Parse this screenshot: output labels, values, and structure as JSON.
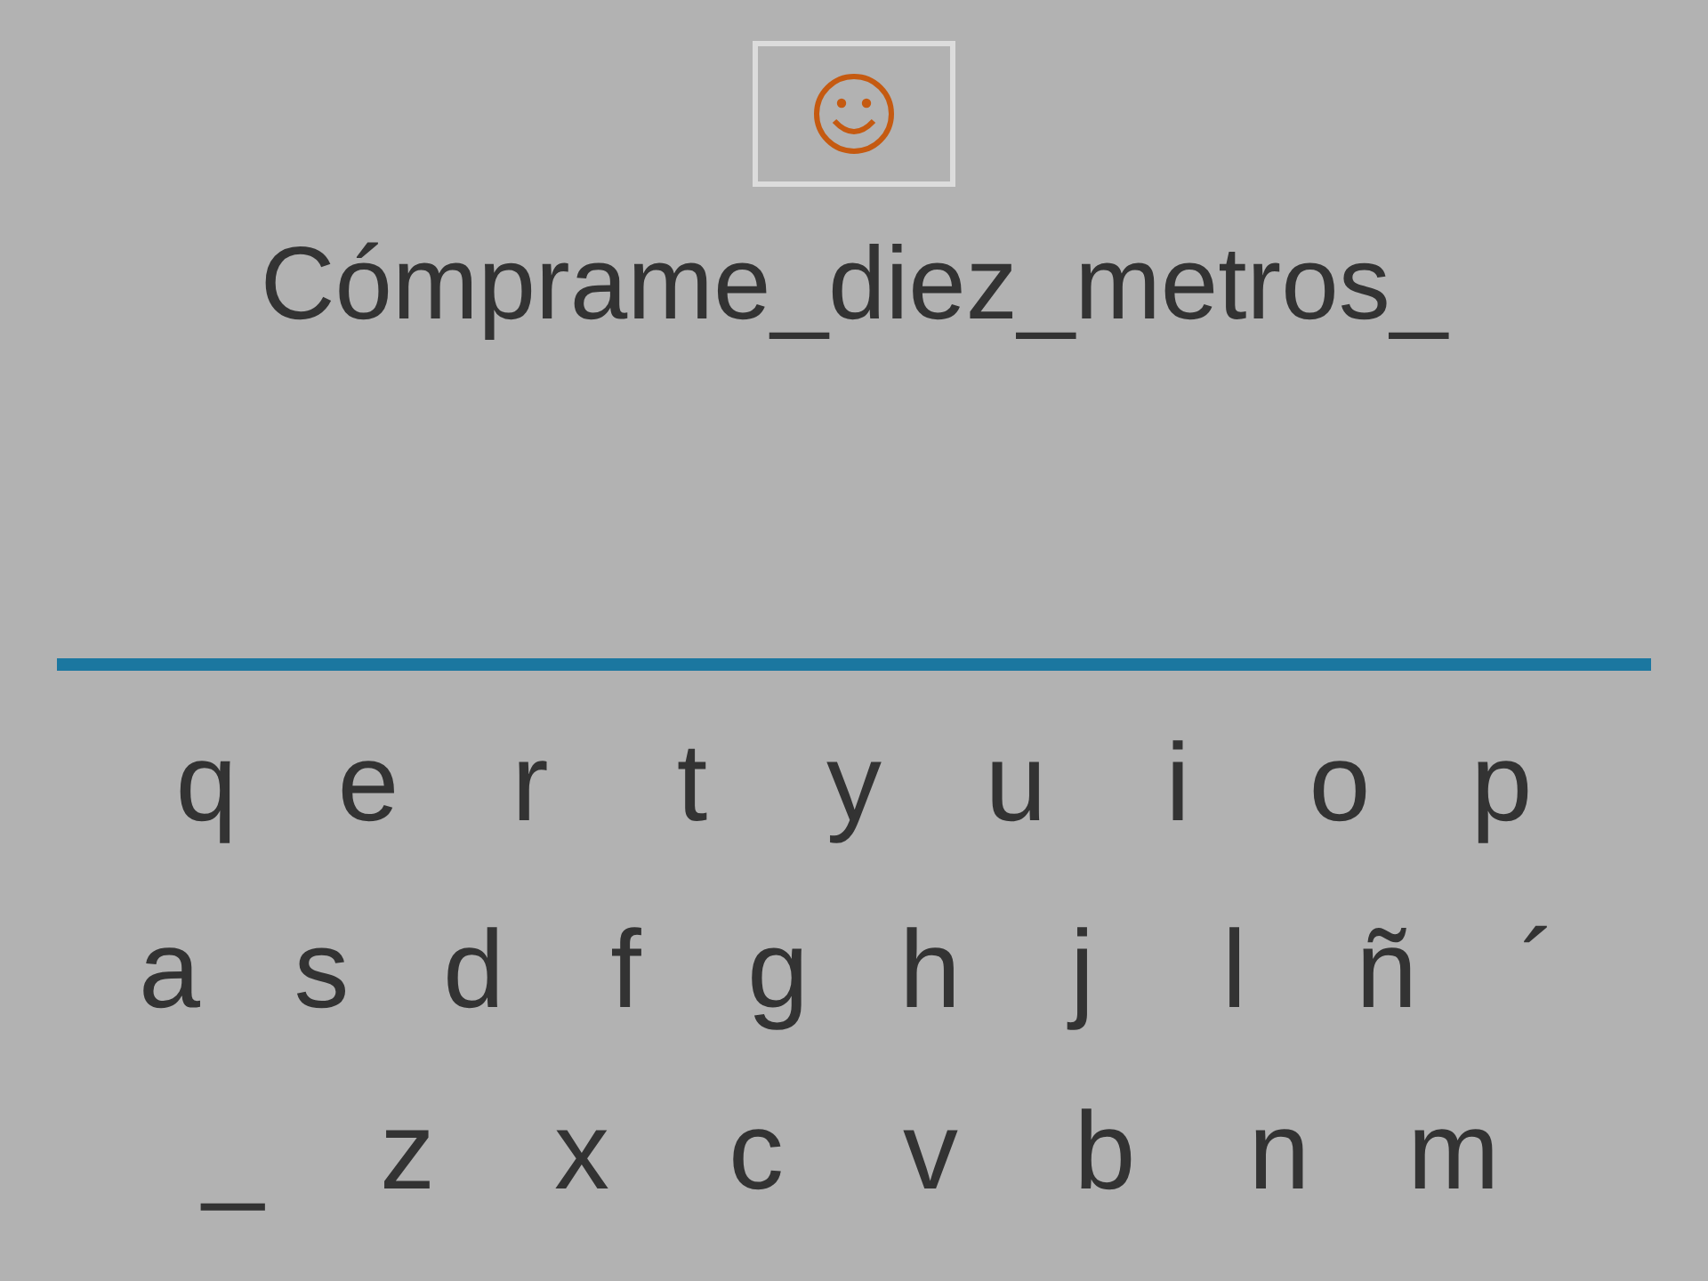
{
  "phrase": "Cómprame_diez_metros_",
  "keyboard": [
    [
      "q",
      "e",
      "r",
      "t",
      "y",
      "u",
      "i",
      "o",
      "p"
    ],
    [
      "a",
      "s",
      "d",
      "f",
      "g",
      "h",
      "j",
      "l",
      "ñ",
      "´"
    ],
    [
      "_",
      "z",
      "x",
      "c",
      "v",
      "b",
      "n",
      "m"
    ]
  ]
}
